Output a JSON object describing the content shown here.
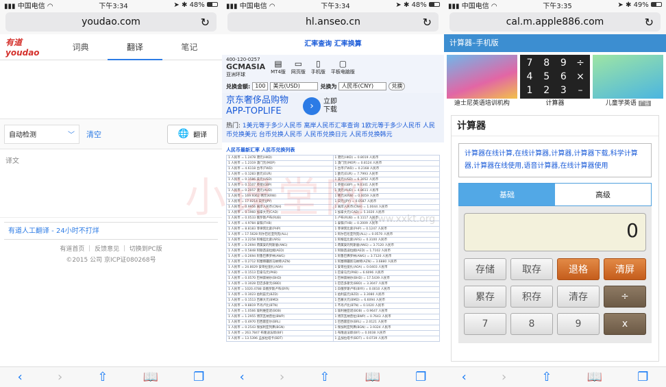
{
  "phones": [
    {
      "status": {
        "carrier": "中国电信",
        "time": "下午3:34",
        "battery": "48%",
        "battery_level": 0.48
      },
      "url": "youdao.com"
    },
    {
      "status": {
        "carrier": "中国电信",
        "time": "下午3:34",
        "battery": "48%",
        "battery_level": 0.48
      },
      "url": "hl.anseo.cn"
    },
    {
      "status": {
        "carrier": "中国电信",
        "time": "下午3:35",
        "battery": "49%",
        "battery_level": 0.49
      },
      "url": "cal.m.apple886.com"
    }
  ],
  "youdao": {
    "logo": "有道 youdao",
    "tabs": [
      "词典",
      "翻译",
      "笔记"
    ],
    "detect": "自动检测",
    "clear": "清空",
    "translate": "翻译",
    "output_placeholder": "译文",
    "human": "有道人工翻译 - 24小时不打烊",
    "footer_links": "有道首页 ｜ 反馈意见 ｜ 切换到PC版",
    "copyright": "©2015 公司 京ICP证080268号"
  },
  "anseo": {
    "top_links": "汇率查询  汇率换算",
    "brand": "GCMASIA",
    "phone": "400-120-0257",
    "brand_sub": "亚洲环球",
    "icons": [
      "MT4版",
      "网页版",
      "手机版",
      "平板电脑版"
    ],
    "form": {
      "amount_label": "兑换金额:",
      "amount": "100",
      "from": "美元(USD)",
      "to_label": "兑换为",
      "to": "人民币(CNY)",
      "submit": "兑换"
    },
    "ad_text": "京东奢侈品购物 APP-TOPLIFE",
    "ad_action": "立即下载",
    "hot_label": "热门:",
    "hot_links": "1美元等于多少人民币 离岸人民币汇率查询 1欧元等于多少人民币 人民币兑换美元 台币兑换人民币 人民币兑换日元 人民币兑换韩元",
    "table_title": "人民币最新汇率  人民币兑换列表",
    "rows": [
      [
        "1 人民币 = 1.2478 港元(HKD)",
        "1 港元(HKD) = 0.8019 人民币"
      ],
      [
        "1 人民币 = 1.2319 澳门元(MOP)",
        "1 澳门元(MOP) = 0.8124 人民币"
      ],
      [
        "1 人民币 = 4.6118 台币(TWD)",
        "1 台币(TWD) = 0.2168 人民币"
      ],
      [
        "1 人民币 = 0.1283 欧元(EUR)",
        "1 欧元(EUR) = 7.7993 人民币"
      ],
      [
        "1 人民币 = 0.1586 美元(USD)",
        "1 美元(USD) = 6.3052 人民币"
      ],
      [
        "1 人民币 = 0.1107 英镑(GBP)",
        "1 英镑(GBP) = 9.0341 人民币"
      ],
      [
        "1 人民币 = 0.2057 澳元(AUD)",
        "1 澳元(AUD) = 4.8611 人民币"
      ],
      [
        "1 人民币 = 169.9362 韩元(KRW)",
        "1 韩元(KRW) = 0.0059 人民币"
      ],
      [
        "1 人民币 = 17.0214 日元(JPY)",
        "1 日元(JPY) = 0.0587 人民币"
      ],
      [
        "1 人民币 = 0.9956 离岸人民币(CNH)",
        "1 离岸人民币(CNH) = 1.0044 人民币"
      ],
      [
        "1 人民币 = 0.1960 加拿大元(CAD)",
        "1 加拿大元(CAD) = 5.1020 人民币"
      ],
      [
        "1 人民币 = 0.0533 俄罗斯卢布(RUB)",
        "1 卢布(RUB) = 0.1117 人民币"
      ],
      [
        "1 人民币 = 4.9784 泰铢(THB)",
        "1 泰铢(THB) = 0.2009 人民币"
      ],
      [
        "1 人民币 = 8.8183 菲律宾比索(PHP)",
        "1 菲律宾比索(PHP) = 0.1247 人民币"
      ],
      [
        "1 人民币 = 17.5628 阿尔巴尼亚列克(ALL)",
        "1 阿尔巴尼亚列克(ALL) = 0.0570 人民币"
      ],
      [
        "1 人民币 = 3.2258 阿根廷比索(ARS)",
        "1 阿根廷比索(ARS) = 0.3100 人民币"
      ],
      [
        "1 人民币 = 0.2694 荷属安的列斯盾(ANG)",
        "1 荷属安的列斯盾(ANG) = 3.7120 人民币"
      ],
      [
        "1 人民币 = 0.5848 阿联酋迪拉姆(AED)",
        "1 阿联酋迪拉姆(AED) = 1.7102 人民币"
      ],
      [
        "1 人民币 = 0.2694 阿鲁巴弗罗林(AWG)",
        "1 阿鲁巴弗罗林(AWG) = 3.7120 人民币"
      ],
      [
        "1 人民币 = 0.2712 阿塞拜疆新马纳特(AZN)",
        "1 阿塞拜疆新马纳特(AZN) = 3.6880 人民币"
      ],
      [
        "1 人民币 = 24.8029 安哥拉宽扎(AOA)",
        "1 安哥拉宽扎(AOA) = 0.0403 人民币"
      ],
      [
        "1 人民币 = 0.1513 巴拿马元(PAB)",
        "1 巴拿马元(PAB) = 6.6096 人民币"
      ],
      [
        "1 人民币 = 0.0570 巴林第纳尔(BHD)",
        "1 巴林第纳尔(BHD) = 17.5439 人民币"
      ],
      [
        "1 人民币 = 0.3028 巴巴多斯元(BBD)",
        "1 巴巴多斯元(BBD) = 3.3047 人民币"
      ],
      [
        "1 人民币 = 1020.4788 白俄罗斯卢布(BYR)",
        "1 白俄罗斯卢布(BYR) = 0.0010 人民币"
      ],
      [
        "1 人民币 = 0.3023 伯利兹元(BZD)",
        "1 伯利兹元(BZD) = 3.3080 人民币"
      ],
      [
        "1 人民币 = 0.1513 百慕大元(BMD)",
        "1 百慕大元(BMD) = 6.6094 人民币"
      ],
      [
        "1 人民币 = 9.8819 不丹卢比(BTN)",
        "1 不丹卢比(BTN) = 0.1020 人民币"
      ],
      [
        "1 人民币 = 1.0566 玻利维亚诺(BOB)",
        "1 玻利维亚诺(BOB) = 0.9647 人民币"
      ],
      [
        "1 人民币 = 1.2955 博茨瓦纳普拉(BWP)",
        "1 博茨瓦纳普拉(BWP) = 0.7643 人民币"
      ],
      [
        "1 人民币 = 0.4970 巴西雷亚尔(BRL)",
        "1 巴西雷亚尔(BRL) = 2.0121 人民币"
      ],
      [
        "1 人民币 = 0.2543 保加利亚列弗(BGN)",
        "1 保加利亚列弗(BGN) = 3.9324 人民币"
      ],
      [
        "1 人民币 = 263.7847 布隆迪法郎(BIF)",
        "1 布隆迪法郎(BIF) = 0.0038 人民币"
      ],
      [
        "1 人民币 = 13.5396 孟加拉塔卡(BDT)",
        "1 孟加拉塔卡(BDT) = 0.0739 人民币"
      ]
    ]
  },
  "calc": {
    "header": "计算器–手机版",
    "ads": [
      {
        "cap": "迪士尼英语培训机构"
      },
      {
        "cap": "计算器",
        "keys": [
          "7",
          "8",
          "9",
          "÷",
          "4",
          "5",
          "6",
          "×",
          "1",
          "2",
          "3",
          "–"
        ]
      },
      {
        "cap": "儿童学英语",
        "tag": "广告"
      }
    ],
    "title": "计算器",
    "desc": "计算器在线计算,在线计算器,计算器,计算器下载,科学计算器,计算器在线使用,语音计算器,在线计算器使用",
    "tabs": [
      "基础",
      "高级"
    ],
    "display": "0",
    "row1": [
      "存储",
      "取存",
      "退格",
      "清屏"
    ],
    "row2": [
      "累存",
      "积存",
      "清存",
      "÷"
    ],
    "row3": [
      "7",
      "8",
      "9",
      "x"
    ]
  },
  "watermark": "小课堂网",
  "watermark_url": "www.xxkt.org"
}
